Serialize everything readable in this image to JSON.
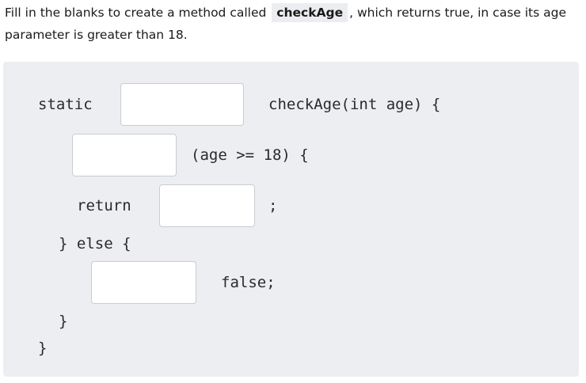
{
  "question": {
    "prefix": "Fill in the blanks to create a method called",
    "method_name": "checkAge",
    "suffix": ", which returns true, in case its age parameter is greater than 18."
  },
  "code": {
    "line1_static": "static",
    "line1_signature": "checkAge(int age) {",
    "line2_condition": "(age >= 18) {",
    "line3_return": "return",
    "line3_semicolon": ";",
    "line4_else": "} else {",
    "line5_false": "false;",
    "line6_close": "}",
    "line7_close": "}"
  },
  "blanks": {
    "return_type": "",
    "if_keyword": "",
    "return_value": "",
    "return_keyword": ""
  }
}
